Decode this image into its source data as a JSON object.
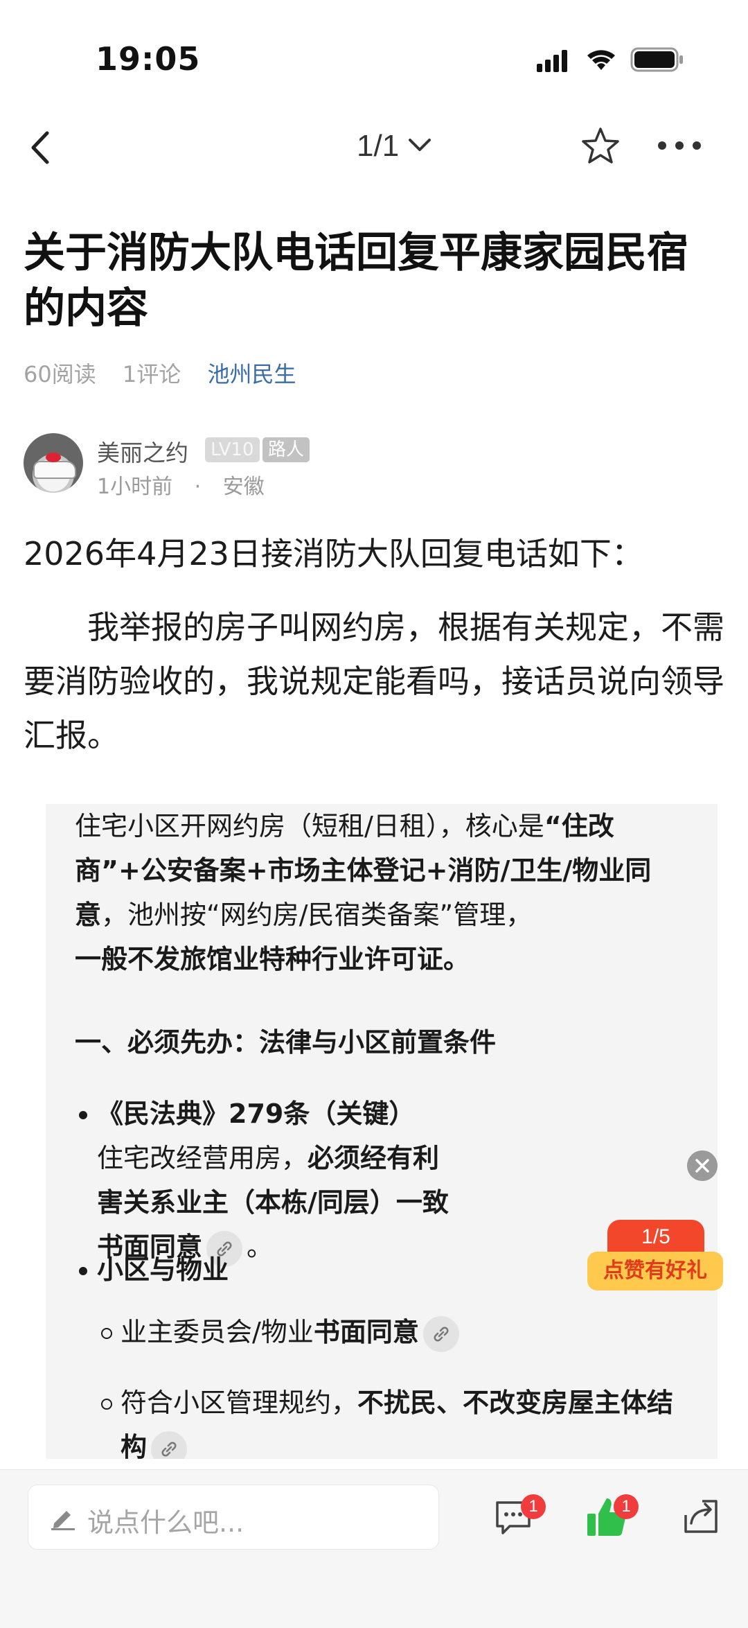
{
  "status_bar": {
    "time": "19:05"
  },
  "nav": {
    "pager": "1/1"
  },
  "article": {
    "title": "关于消防大队电话回复平康家园民宿的内容",
    "reads": "60阅读",
    "comments": "1评论",
    "topic": "池州民生",
    "author": {
      "name": "美丽之约",
      "level": "LV10",
      "role": "路人",
      "time": "1小时前",
      "location": "安徽"
    },
    "para1": "2026年4月23日接消防大队回复电话如下：",
    "para2": "我举报的房子叫网约房，根据有关规定，不需要消防验收的，我说规定能看吗，接话员说向领导汇报。"
  },
  "card": {
    "intro_a": "住宅小区开网约房（短租/日租），核心是",
    "intro_b": "“住改商”+公安备案+市场主体登记+消防/卫生/物业同意",
    "intro_c": "，池州按“网约房/民宿类备案”管理，",
    "intro_d": "一般不发旅馆业特种行业许可证。",
    "heading1": "一、必须先办：法律与小区前置条件",
    "b1_title": "《民法典》279条（关键）",
    "b1_text_a": "住宅改经营用房，",
    "b1_text_b": "必须经有利害关系业主（本栋/同层）一致书面同意",
    "b1_text_end": "。",
    "b2_title": "小区与物业",
    "b2_sub1_a": "业主委员会/物业",
    "b2_sub1_b": "书面同意",
    "b2_sub2_a": "符合小区管理规约，",
    "b2_sub2_b": "不扰民、不改变房屋主体结构"
  },
  "promo": {
    "counter": "1/5",
    "label": "点赞有好礼"
  },
  "bottom_bar": {
    "placeholder": "说点什么吧...",
    "comment_count": "1",
    "like_count": "1"
  },
  "colors": {
    "topic": "#3a6ea8",
    "badge_red": "#f03c3c",
    "like_green": "#2fbf4a",
    "promo_red": "#f2472a",
    "promo_yellow": "#ffc94d"
  },
  "icons": [
    "back-icon",
    "chevron-down-icon",
    "star-icon",
    "more-icon",
    "link-icon",
    "close-icon",
    "pen-icon",
    "comment-icon",
    "like-icon",
    "share-icon"
  ]
}
